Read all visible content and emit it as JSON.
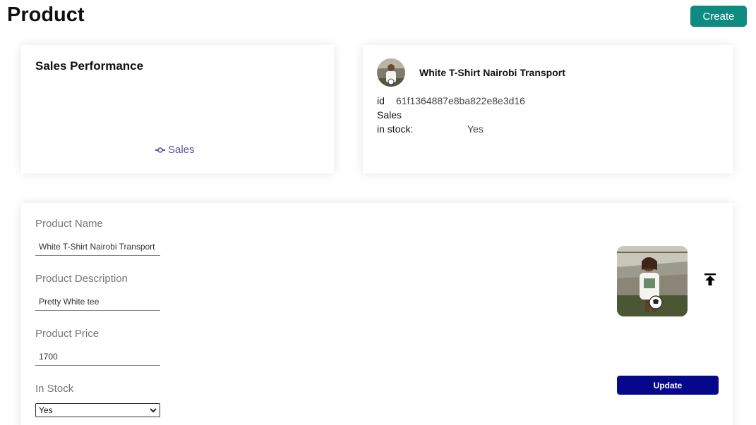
{
  "header": {
    "title": "Product",
    "create_label": "Create"
  },
  "sales_chart": {
    "title": "Sales Performance",
    "legend_label": "Sales",
    "legend_color": "#5a55a6"
  },
  "product_info": {
    "name": "White T-Shirt Nairobi Transport",
    "id_label": "id",
    "id_value": "61f1364887e8ba822e8e3d16",
    "sales_label": "Sales",
    "stock_label": "in stock:",
    "stock_value": "Yes"
  },
  "form": {
    "name_label": "Product Name",
    "name_value": "White T-Shirt Nairobi Transport",
    "description_label": "Product Description",
    "description_value": "Pretty White tee",
    "price_label": "Product Price",
    "price_value": "1700",
    "stock_label": "In Stock",
    "stock_selected": "Yes",
    "update_label": "Update"
  },
  "colors": {
    "create_button": "#0f8a80",
    "update_button": "#07078c"
  },
  "icons": {
    "upload": "upload-icon",
    "dropdown": "chevron-down-icon",
    "legend": "line-legend-icon"
  }
}
